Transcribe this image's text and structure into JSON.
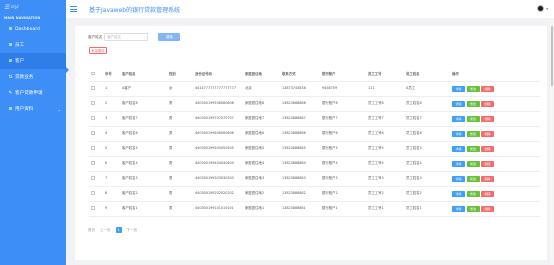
{
  "sidebar": {
    "logo": "ziyi",
    "caption": "MAIN NAVIGATION",
    "items": [
      {
        "label": "Dashboard",
        "icon": "dashboard-icon",
        "glyph": "⊞"
      },
      {
        "label": "员工",
        "icon": "grid-icon",
        "glyph": "⊞"
      },
      {
        "label": "客户",
        "icon": "grid-icon",
        "glyph": "⊞"
      },
      {
        "label": "贷款业务",
        "icon": "list-icon",
        "glyph": "⇅"
      },
      {
        "label": "客户贷款申请",
        "icon": "pen-icon",
        "glyph": "✎"
      },
      {
        "label": "用户资料",
        "icon": "grid-icon",
        "glyph": "⊞"
      }
    ]
  },
  "header": {
    "title": "基于Javaweb的银行贷款管理系统",
    "user_arrow": "▾"
  },
  "search": {
    "label": "客户姓名",
    "placeholder": "客户姓名",
    "button": "搜索"
  },
  "batch_delete": "批量删除",
  "table": {
    "headers": [
      "",
      "序号",
      "客户姓名",
      "性别",
      "身份证号码",
      "家庭居住地",
      "联系方式",
      "银行账户",
      "员工工号",
      "员工姓名",
      "操作"
    ],
    "actions": {
      "detail": "详情",
      "edit": "修改",
      "delete": "删除"
    },
    "rows": [
      [
        "1",
        "A客户",
        "女",
        "4414777777777777777",
        "北京",
        "13873745838",
        "9458759",
        "111",
        "A员工"
      ],
      [
        "2",
        "客户姓名8",
        "男",
        "440300199508080808",
        "家庭居住地8",
        "13823888888",
        "银行账户8",
        "员工工号8",
        "员工姓名8"
      ],
      [
        "3",
        "客户姓名7",
        "男",
        "440300199707070707",
        "家庭居住地7",
        "13823888887",
        "银行账户7",
        "员工工号7",
        "员工姓名7"
      ],
      [
        "4",
        "客户姓名6",
        "男",
        "440300199606060606",
        "家庭居住地6",
        "13823888886",
        "银行账户6",
        "员工工号6",
        "员工姓名6"
      ],
      [
        "5",
        "客户姓名5",
        "男",
        "440300199505050505",
        "家庭居住地5",
        "13823888885",
        "银行账户5",
        "员工工号5",
        "员工姓名5"
      ],
      [
        "6",
        "客户姓名4",
        "男",
        "440300199404040404",
        "家庭居住地4",
        "13823888884",
        "银行账户4",
        "员工工号4",
        "员工姓名4"
      ],
      [
        "7",
        "客户姓名3",
        "男",
        "440300199303030303",
        "家庭居住地3",
        "13823888883",
        "银行账户3",
        "员工工号3",
        "员工姓名3"
      ],
      [
        "8",
        "客户姓名2",
        "男",
        "440300199202020202",
        "家庭居住地2",
        "13823888882",
        "银行账户2",
        "员工工号2",
        "员工姓名2"
      ],
      [
        "9",
        "客户姓名1",
        "男",
        "440300199101010101",
        "家庭居住地1",
        "13823888881",
        "银行账户1",
        "员工工号1",
        "员工姓名1"
      ]
    ]
  },
  "pagination": {
    "prev_first": "首页",
    "prev": "上一页",
    "current": "1",
    "next": "下一页"
  },
  "colors": {
    "sidebar": "#3e8ef7",
    "detail": "#409eff",
    "edit": "#67c23a",
    "delete": "#f56c6c"
  }
}
